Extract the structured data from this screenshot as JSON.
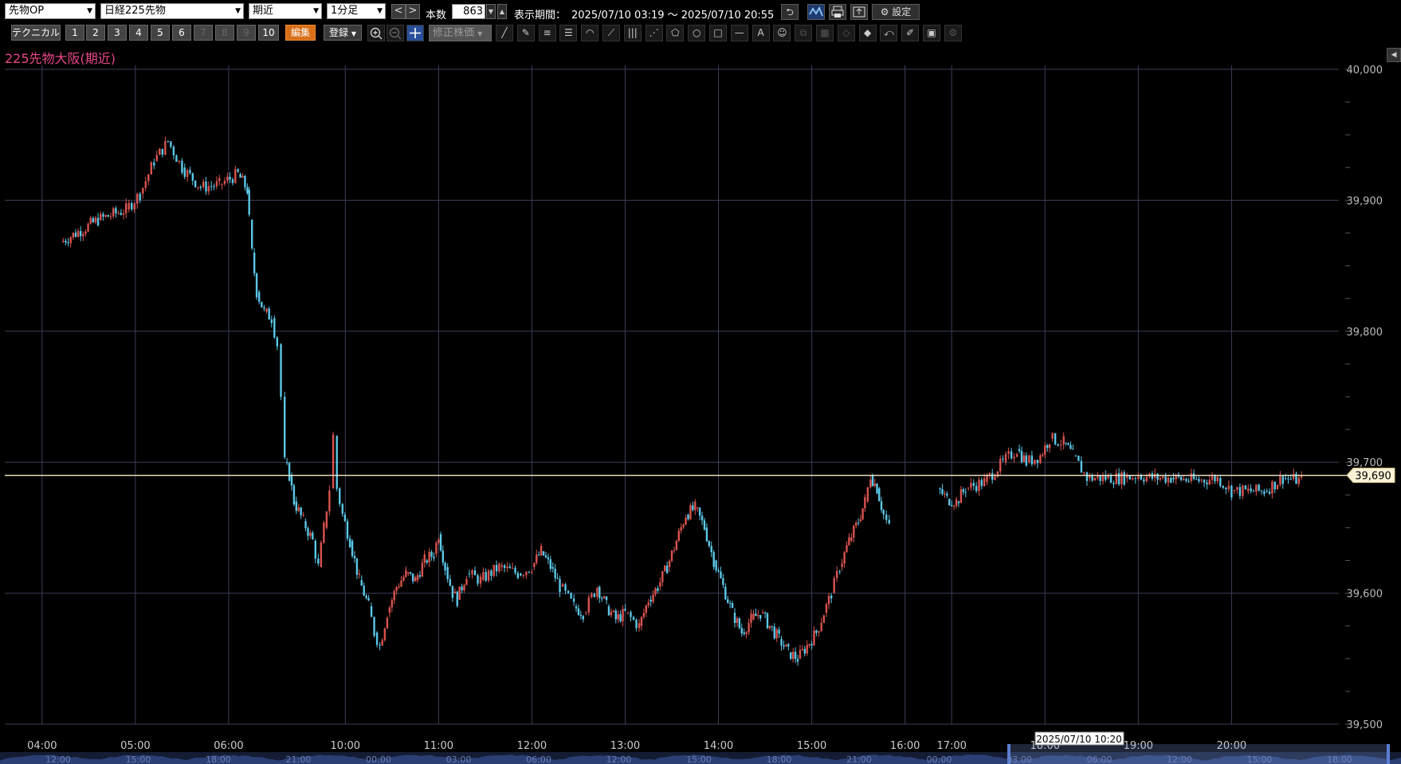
{
  "toolbar": {
    "market_select": "先物OP",
    "symbol_select": "日経225先物",
    "contract_select": "期近",
    "interval_select": "1分足",
    "prev_label": "<",
    "next_label": ">",
    "count_label": "本数",
    "count_value": "863",
    "period_label": "表示期間：",
    "period_value": "2025/07/10 03:19 ～ 2025/07/10 20:55",
    "settings_label": "設定"
  },
  "toolbar2": {
    "technical_label": "テクニカル",
    "presets": [
      "1",
      "2",
      "3",
      "4",
      "5",
      "6",
      "7",
      "8",
      "9",
      "10"
    ],
    "edit_label": "編集",
    "register_label": "登録",
    "adjusted_price_label": "修正株価"
  },
  "chart_title": "225先物大阪(期近)",
  "colors": {
    "up_candle": "#d9534f",
    "down_candle": "#5bc8e8",
    "grid": "#3c3f58",
    "current_price_line": "#f3eac8",
    "title": "#e8478a"
  },
  "chart_data": {
    "type": "candlestick",
    "y_axis": {
      "ylim": [
        39500,
        40000
      ],
      "ticks": [
        "39,500",
        "39,600",
        "39,700",
        "39,800",
        "39,900",
        "40,000"
      ],
      "minor_step": 25
    },
    "x_axis": {
      "ticks": [
        {
          "label": "04:00",
          "t": 0.4
        },
        {
          "label": "05:00",
          "t": 1.4
        },
        {
          "label": "06:00",
          "t": 2.4
        },
        {
          "label": "10:00",
          "t": 3.65
        },
        {
          "label": "11:00",
          "t": 4.65
        },
        {
          "label": "12:00",
          "t": 5.65
        },
        {
          "label": "13:00",
          "t": 6.65
        },
        {
          "label": "14:00",
          "t": 7.65
        },
        {
          "label": "15:00",
          "t": 8.65
        },
        {
          "label": "16:00",
          "t": 9.65
        },
        {
          "label": "17:00",
          "t": 10.15
        },
        {
          "label": "18:00",
          "t": 11.15
        },
        {
          "label": "19:00",
          "t": 12.15
        },
        {
          "label": "20:00",
          "t": 13.15
        }
      ],
      "range": [
        0,
        14.3
      ]
    },
    "current_price": 39690,
    "current_price_label": "39,690",
    "crosshair_time_label": "2025/07/10 10:20",
    "series_path": [
      [
        0.0,
        39866
      ],
      [
        0.6,
        39868
      ],
      [
        1.0,
        39885
      ],
      [
        1.3,
        39893
      ],
      [
        1.45,
        39905
      ],
      [
        1.6,
        39930
      ],
      [
        1.75,
        39945
      ],
      [
        1.9,
        39925
      ],
      [
        2.1,
        39910
      ],
      [
        2.3,
        39912
      ],
      [
        2.5,
        39920
      ],
      [
        2.6,
        39908
      ],
      [
        2.62,
        39885
      ],
      [
        2.65,
        39860
      ],
      [
        2.7,
        39830
      ],
      [
        2.78,
        39815
      ],
      [
        2.86,
        39810
      ],
      [
        2.92,
        39790
      ],
      [
        2.96,
        39750
      ],
      [
        3.0,
        39700
      ],
      [
        3.05,
        39690
      ],
      [
        3.1,
        39670
      ],
      [
        3.2,
        39655
      ],
      [
        3.3,
        39640
      ],
      [
        3.36,
        39620
      ],
      [
        3.42,
        39650
      ],
      [
        3.48,
        39680
      ],
      [
        3.52,
        39720
      ],
      [
        3.56,
        39680
      ],
      [
        3.62,
        39660
      ],
      [
        3.7,
        39640
      ],
      [
        3.8,
        39610
      ],
      [
        3.9,
        39590
      ],
      [
        3.96,
        39570
      ],
      [
        4.02,
        39560
      ],
      [
        4.1,
        39585
      ],
      [
        4.2,
        39605
      ],
      [
        4.3,
        39615
      ],
      [
        4.4,
        39610
      ],
      [
        4.5,
        39625
      ],
      [
        4.6,
        39630
      ],
      [
        4.65,
        39645
      ],
      [
        4.72,
        39620
      ],
      [
        4.8,
        39600
      ],
      [
        4.85,
        39595
      ],
      [
        4.95,
        39615
      ],
      [
        5.1,
        39610
      ],
      [
        5.3,
        39620
      ],
      [
        5.5,
        39615
      ],
      [
        5.65,
        39620
      ],
      [
        5.75,
        39632
      ],
      [
        5.85,
        39620
      ],
      [
        5.95,
        39605
      ],
      [
        6.1,
        39590
      ],
      [
        6.2,
        39585
      ],
      [
        6.35,
        39605
      ],
      [
        6.45,
        39590
      ],
      [
        6.55,
        39580
      ],
      [
        6.65,
        39585
      ],
      [
        6.8,
        39575
      ],
      [
        6.9,
        39595
      ],
      [
        7.0,
        39605
      ],
      [
        7.1,
        39620
      ],
      [
        7.2,
        39640
      ],
      [
        7.3,
        39660
      ],
      [
        7.4,
        39665
      ],
      [
        7.5,
        39650
      ],
      [
        7.6,
        39625
      ],
      [
        7.7,
        39605
      ],
      [
        7.8,
        39585
      ],
      [
        7.9,
        39570
      ],
      [
        8.0,
        39580
      ],
      [
        8.1,
        39585
      ],
      [
        8.2,
        39575
      ],
      [
        8.3,
        39565
      ],
      [
        8.4,
        39555
      ],
      [
        8.5,
        39550
      ],
      [
        8.6,
        39560
      ],
      [
        8.7,
        39570
      ],
      [
        8.78,
        39585
      ],
      [
        8.86,
        39600
      ],
      [
        8.95,
        39620
      ],
      [
        9.05,
        39640
      ],
      [
        9.15,
        39655
      ],
      [
        9.22,
        39670
      ],
      [
        9.28,
        39690
      ],
      [
        9.35,
        39680
      ],
      [
        9.42,
        39660
      ],
      [
        9.48,
        39650
      ],
      [
        10.0,
        39680
      ],
      [
        10.1,
        39672
      ],
      [
        10.2,
        39670
      ],
      [
        10.3,
        39680
      ],
      [
        10.5,
        39685
      ],
      [
        10.7,
        39700
      ],
      [
        10.85,
        39710
      ],
      [
        10.95,
        39700
      ],
      [
        11.1,
        39705
      ],
      [
        11.2,
        39718
      ],
      [
        11.35,
        39715
      ],
      [
        11.45,
        39705
      ],
      [
        11.6,
        39688
      ],
      [
        11.8,
        39688
      ],
      [
        12.0,
        39688
      ],
      [
        12.15,
        39690
      ],
      [
        12.3,
        39688
      ],
      [
        12.5,
        39688
      ],
      [
        12.8,
        39686
      ],
      [
        13.0,
        39688
      ],
      [
        13.15,
        39678
      ],
      [
        13.3,
        39678
      ],
      [
        13.5,
        39678
      ],
      [
        13.7,
        39688
      ],
      [
        13.9,
        39686
      ]
    ]
  },
  "navigator": {
    "date_labels": [
      "12:00",
      "15:00",
      "18:00",
      "21:00",
      "00:00",
      "03:00",
      "06:00",
      "12:00",
      "15:00",
      "18:00",
      "21:00",
      "00:00",
      "03:00",
      "06:00",
      "12:00",
      "15:00",
      "18:00"
    ]
  }
}
